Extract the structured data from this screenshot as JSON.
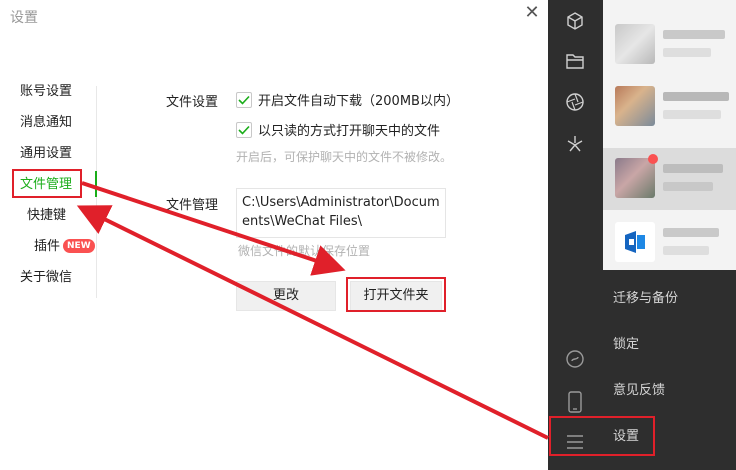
{
  "settings_window": {
    "title": "设置",
    "close_glyph": "✕",
    "nav": [
      {
        "label": "账号设置",
        "active": false
      },
      {
        "label": "消息通知",
        "active": false
      },
      {
        "label": "通用设置",
        "active": false
      },
      {
        "label": "文件管理",
        "active": true
      },
      {
        "label": "快捷键",
        "active": false
      },
      {
        "label": "插件",
        "active": false,
        "badge": "NEW"
      },
      {
        "label": "关于微信",
        "active": false
      }
    ],
    "file_settings": {
      "label": "文件设置",
      "options": [
        {
          "label": "开启文件自动下载（200MB以内）",
          "checked": true
        },
        {
          "label": "以只读的方式打开聊天中的文件",
          "checked": true
        }
      ],
      "hint": "开启后，可保护聊天中的文件不被修改。"
    },
    "file_management": {
      "label": "文件管理",
      "path": "C:\\Users\\Administrator\\Documents\\WeChat Files\\",
      "hint": "微信文件的默认保存位置",
      "change_button": "更改",
      "open_folder_button": "打开文件夹"
    }
  },
  "wechat_panel": {
    "sidebar_icons": [
      "cube-icon",
      "folder-icon",
      "aperture-icon",
      "sparkle-icon",
      "mini-program-icon",
      "phone-icon",
      "menu-icon"
    ],
    "menu": [
      {
        "label": "迁移与备份"
      },
      {
        "label": "锁定"
      },
      {
        "label": "意见反馈"
      },
      {
        "label": "设置"
      }
    ]
  },
  "colors": {
    "accent_green": "#1aad19",
    "annotation_red": "#e0202a",
    "sidebar_dark": "#2e2e2e",
    "badge_red": "#fa5151"
  }
}
